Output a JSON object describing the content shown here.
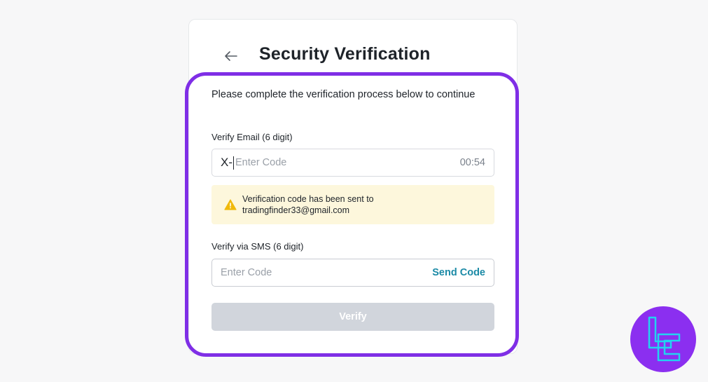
{
  "page": {
    "title": "Security Verification",
    "intro": "Please complete the verification process below to continue"
  },
  "email": {
    "label": "Verify Email (6 digit)",
    "typed_value": "X-",
    "placeholder": "Enter Code",
    "timer": "00:54"
  },
  "notice": {
    "line1": "Verification code has been sent to",
    "line2": "tradingfinder33@gmail.com"
  },
  "sms": {
    "label": "Verify via SMS (6 digit)",
    "placeholder": "Enter Code",
    "send_label": "Send Code"
  },
  "actions": {
    "verify_label": "Verify"
  },
  "colors": {
    "accent_outline": "#7f2ee6",
    "link": "#1b8aa6",
    "notice_bg": "#fdf7dc",
    "warning_icon": "#f0b90b",
    "button_disabled": "#d1d5dc",
    "logo_bg": "#8b2ff0",
    "logo_stroke": "#22d4f0"
  },
  "icons": {
    "back": "arrow-left-icon",
    "warning": "warning-icon",
    "brand": "brand-logo-icon"
  }
}
